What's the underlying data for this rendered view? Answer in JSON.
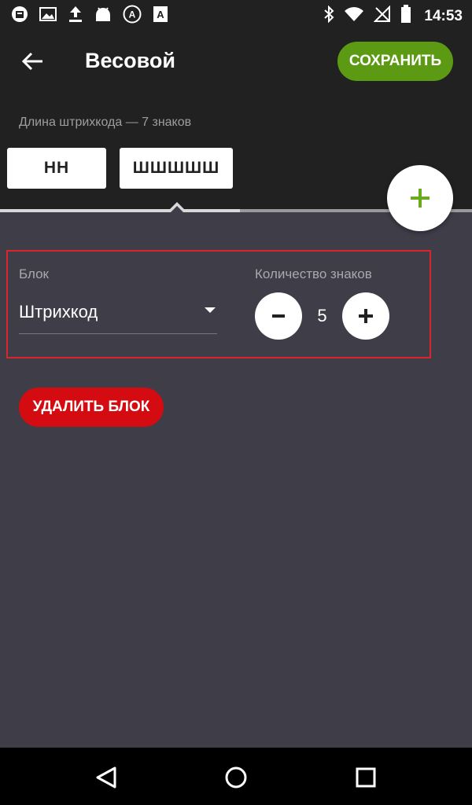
{
  "status_bar": {
    "time": "14:53",
    "icons": [
      "app-notification-icon",
      "image-icon",
      "upload-icon",
      "android-icon",
      "accessibility-icon",
      "text-icon",
      "bluetooth-icon",
      "wifi-icon",
      "no-sim-icon",
      "battery-icon"
    ]
  },
  "header": {
    "title": "Весовой",
    "save_label": "СОХРАНИТЬ"
  },
  "barcode": {
    "length_label": "Длина штрихкода — 7 знаков",
    "segments": [
      {
        "label": "НН"
      },
      {
        "label": "ШШШШШ"
      }
    ]
  },
  "block": {
    "block_label": "Блок",
    "block_value": "Штрихкод",
    "count_label": "Количество знаков",
    "count_value": "5"
  },
  "actions": {
    "delete_label": "УДАЛИТЬ БЛОК"
  },
  "colors": {
    "save_green": "#5c9a14",
    "delete_red": "#d50b12",
    "fab_plus_green": "#6aab1e",
    "highlight_red": "#d9252b"
  }
}
